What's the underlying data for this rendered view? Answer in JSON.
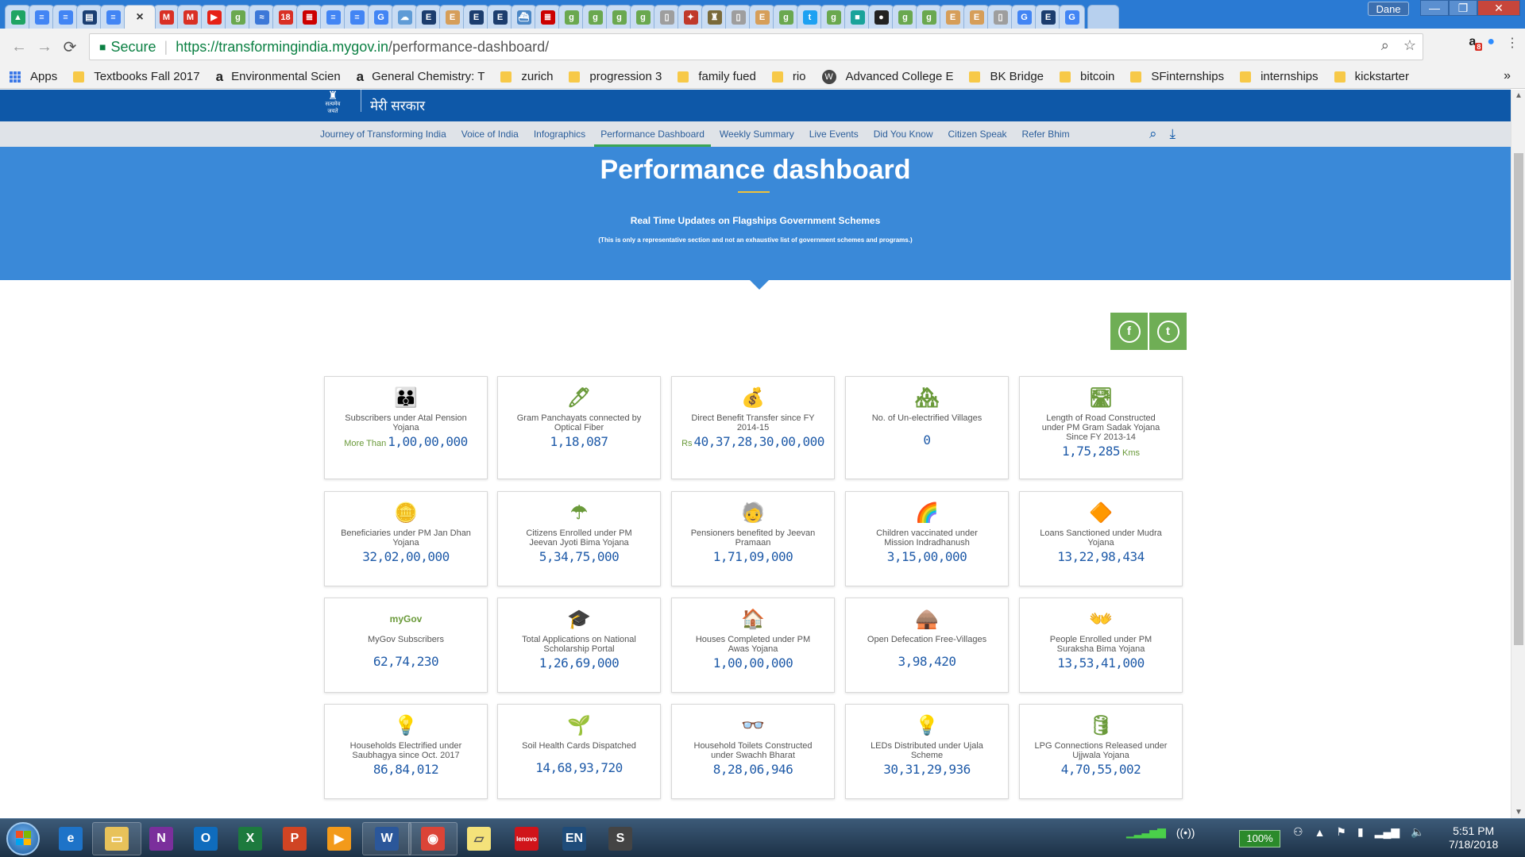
{
  "browser": {
    "tabs": [
      {
        "icon": "drive-icon",
        "glyph": "▲",
        "color": "#1fa463"
      },
      {
        "icon": "docs-icon",
        "glyph": "≡",
        "color": "#4285f4"
      },
      {
        "icon": "docs-icon",
        "glyph": "≡",
        "color": "#4285f4"
      },
      {
        "icon": "ieee-icon",
        "glyph": "▤",
        "color": "#1b3f73"
      },
      {
        "icon": "docs-icon",
        "glyph": "≡",
        "color": "#4285f4"
      },
      {
        "icon": "close-icon",
        "glyph": "×",
        "color": "#f2f2f2",
        "active": true
      },
      {
        "icon": "gmail-icon",
        "glyph": "M",
        "color": "#d93025"
      },
      {
        "icon": "gmail-icon",
        "glyph": "M",
        "color": "#d93025"
      },
      {
        "icon": "youtube-icon",
        "glyph": "▶",
        "color": "#e62117"
      },
      {
        "icon": "mygov-icon",
        "glyph": "g",
        "color": "#6aa84f"
      },
      {
        "icon": "water-icon",
        "glyph": "≈",
        "color": "#3c78d8"
      },
      {
        "icon": "calendar-icon",
        "glyph": "18",
        "color": "#d93025"
      },
      {
        "icon": "bars-icon",
        "glyph": "≣",
        "color": "#cc0000"
      },
      {
        "icon": "docs-icon",
        "glyph": "≡",
        "color": "#4285f4"
      },
      {
        "icon": "docs-icon",
        "glyph": "≡",
        "color": "#4285f4"
      },
      {
        "icon": "google-icon",
        "glyph": "G",
        "color": "#4285f4"
      },
      {
        "icon": "cloud-icon",
        "glyph": "☁",
        "color": "#5f9bd6"
      },
      {
        "icon": "e-icon",
        "glyph": "E",
        "color": "#1c3d6e"
      },
      {
        "icon": "e-book-icon",
        "glyph": "E",
        "color": "#d69e59"
      },
      {
        "icon": "e-icon",
        "glyph": "E",
        "color": "#1c3d6e"
      },
      {
        "icon": "e-icon",
        "glyph": "E",
        "color": "#1c3d6e"
      },
      {
        "icon": "ship-icon",
        "glyph": "⛴",
        "color": "#4a86c5"
      },
      {
        "icon": "bars-icon",
        "glyph": "≣",
        "color": "#cc0000"
      },
      {
        "icon": "mygov-icon",
        "glyph": "g",
        "color": "#6aa84f"
      },
      {
        "icon": "mygov-icon",
        "glyph": "g",
        "color": "#6aa84f"
      },
      {
        "icon": "mygov-icon",
        "glyph": "g",
        "color": "#6aa84f"
      },
      {
        "icon": "mygov-icon",
        "glyph": "g",
        "color": "#6aa84f"
      },
      {
        "icon": "page-icon",
        "glyph": "▯",
        "color": "#9e9e9e"
      },
      {
        "icon": "bird-icon",
        "glyph": "✦",
        "color": "#c0392b"
      },
      {
        "icon": "emblem-icon",
        "glyph": "♜",
        "color": "#7a6a3a"
      },
      {
        "icon": "page-icon",
        "glyph": "▯",
        "color": "#9e9e9e"
      },
      {
        "icon": "e-book-icon",
        "glyph": "E",
        "color": "#d69e59"
      },
      {
        "icon": "mygov-icon",
        "glyph": "g",
        "color": "#6aa84f"
      },
      {
        "icon": "twitter-icon",
        "glyph": "t",
        "color": "#1da1f2"
      },
      {
        "icon": "mygov-icon",
        "glyph": "g",
        "color": "#6aa84f"
      },
      {
        "icon": "teal-square-icon",
        "glyph": "■",
        "color": "#1aa39a"
      },
      {
        "icon": "github-icon",
        "glyph": "●",
        "color": "#222222"
      },
      {
        "icon": "mygov-icon",
        "glyph": "g",
        "color": "#6aa84f"
      },
      {
        "icon": "mygov-icon",
        "glyph": "g",
        "color": "#6aa84f"
      },
      {
        "icon": "e-book-icon",
        "glyph": "E",
        "color": "#d69e59"
      },
      {
        "icon": "e-book-icon",
        "glyph": "E",
        "color": "#d69e59"
      },
      {
        "icon": "page-icon",
        "glyph": "▯",
        "color": "#9e9e9e"
      },
      {
        "icon": "google-icon",
        "glyph": "G",
        "color": "#4285f4"
      },
      {
        "icon": "e-icon",
        "glyph": "E",
        "color": "#1c3d6e"
      },
      {
        "icon": "google-icon",
        "glyph": "G",
        "color": "#4285f4"
      }
    ],
    "user": "Dane",
    "window_buttons": {
      "minimize": "—",
      "maximize": "❐",
      "close": "✕"
    },
    "address": {
      "secure_label": "Secure",
      "url_scheme": "https://",
      "url_host": "transformingindia.mygov.in",
      "url_path": "/performance-dashboard/"
    },
    "bookmarks": [
      {
        "type": "apps",
        "label": "Apps"
      },
      {
        "type": "folder",
        "label": "Textbooks Fall 2017"
      },
      {
        "type": "amazon",
        "label": "Environmental Scien"
      },
      {
        "type": "amazon",
        "label": "General Chemistry: T"
      },
      {
        "type": "folder",
        "label": "zurich"
      },
      {
        "type": "folder",
        "label": "progression 3"
      },
      {
        "type": "folder",
        "label": "family fued"
      },
      {
        "type": "folder",
        "label": "rio"
      },
      {
        "type": "wordpress",
        "label": "Advanced College E"
      },
      {
        "type": "folder",
        "label": "BK Bridge"
      },
      {
        "type": "folder",
        "label": "bitcoin"
      },
      {
        "type": "folder",
        "label": "SFinternships"
      },
      {
        "type": "folder",
        "label": "internships"
      },
      {
        "type": "folder",
        "label": "kickstarter"
      }
    ],
    "bookmarks_more": "»",
    "extension_badge": "8"
  },
  "site": {
    "logo_hindi": "मेरी सरकार",
    "logo_emblem_caption": "सत्यमेव जयते",
    "nav": [
      {
        "label": "Journey of Transforming India",
        "active": false
      },
      {
        "label": "Voice of India",
        "active": false
      },
      {
        "label": "Infographics",
        "active": false
      },
      {
        "label": "Performance Dashboard",
        "active": true
      },
      {
        "label": "Weekly Summary",
        "active": false
      },
      {
        "label": "Live Events",
        "active": false
      },
      {
        "label": "Did You Know",
        "active": false
      },
      {
        "label": "Citizen Speak",
        "active": false
      },
      {
        "label": "Refer Bhim",
        "active": false
      }
    ],
    "hero": {
      "title": "Performance dashboard",
      "subtitle": "Real Time Updates on Flagships Government Schemes",
      "note": "(This is only a representative section and not an exhaustive list of government schemes and programs.)"
    },
    "share": {
      "facebook": "f",
      "twitter": "t"
    },
    "colors": {
      "header": "#0e58a8",
      "hero": "#3a89d8",
      "value": "#1e5aa8",
      "share": "#6fae55",
      "accent": "#3aa655"
    },
    "cards": [
      {
        "title": "Subscribers under Atal Pension Yojana",
        "prefix": "More Than",
        "value": "1,00,00,000",
        "suffix": "",
        "icon": "pension-family-icon",
        "emoji": "👪"
      },
      {
        "title": "Gram Panchayats connected by Optical Fiber",
        "prefix": "",
        "value": "1,18,087",
        "suffix": "",
        "icon": "optical-fiber-icon",
        "emoji": "🖊"
      },
      {
        "title": "Direct Benefit Transfer since FY 2014-15",
        "prefix": "Rs",
        "value": "40,37,28,30,00,000",
        "suffix": "",
        "icon": "money-bag-icon",
        "emoji": "💰"
      },
      {
        "title": "No. of Un-electrified Villages",
        "prefix": "",
        "value": "0",
        "suffix": "",
        "icon": "village-icon",
        "emoji": "🏘"
      },
      {
        "title": "Length of Road Constructed under PM Gram Sadak Yojana Since FY 2013-14",
        "prefix": "",
        "value": "1,75,285",
        "suffix": "Kms",
        "icon": "road-icon",
        "emoji": "🛣"
      },
      {
        "title": "Beneficiaries under PM Jan Dhan Yojana",
        "prefix": "",
        "value": "32,02,00,000",
        "suffix": "",
        "icon": "coins-icon",
        "emoji": "🪙"
      },
      {
        "title": "Citizens Enrolled under PM Jeevan Jyoti Bima Yojana",
        "prefix": "",
        "value": "5,34,75,000",
        "suffix": "",
        "icon": "umbrella-family-icon",
        "emoji": "☂"
      },
      {
        "title": "Pensioners benefited by Jeevan Pramaan",
        "prefix": "",
        "value": "1,71,09,000",
        "suffix": "",
        "icon": "pensioner-icon",
        "emoji": "🧓"
      },
      {
        "title": "Children vaccinated under Mission Indradhanush",
        "prefix": "",
        "value": "3,15,00,000",
        "suffix": "",
        "icon": "rainbow-icon",
        "emoji": "🌈"
      },
      {
        "title": "Loans Sanctioned under Mudra Yojana",
        "prefix": "",
        "value": "13,22,98,434",
        "suffix": "",
        "icon": "mudra-logo-icon",
        "emoji": "🔶"
      },
      {
        "title": "MyGov Subscribers",
        "prefix": "",
        "value": "62,74,230",
        "suffix": "",
        "icon": "mygov-logo-icon",
        "emoji": "myGov"
      },
      {
        "title": "Total Applications on National Scholarship Portal",
        "prefix": "",
        "value": "1,26,69,000",
        "suffix": "",
        "icon": "graduation-cap-icon",
        "emoji": "🎓"
      },
      {
        "title": "Houses Completed under PM Awas Yojana",
        "prefix": "",
        "value": "1,00,00,000",
        "suffix": "",
        "icon": "house-icon",
        "emoji": "🏠"
      },
      {
        "title": "Open Defecation Free-Villages",
        "prefix": "",
        "value": "3,98,420",
        "suffix": "",
        "icon": "hut-tree-icon",
        "emoji": "🛖"
      },
      {
        "title": "People Enrolled under PM Suraksha Bima Yojana",
        "prefix": "",
        "value": "13,53,41,000",
        "suffix": "",
        "icon": "protected-family-icon",
        "emoji": "👐"
      },
      {
        "title": "Households Electrified under Saubhagya since Oct. 2017",
        "prefix": "",
        "value": "86,84,012",
        "suffix": "",
        "icon": "bulbs-icon",
        "emoji": "💡"
      },
      {
        "title": "Soil Health Cards Dispatched",
        "prefix": "",
        "value": "14,68,93,720",
        "suffix": "",
        "icon": "plant-hands-icon",
        "emoji": "🌱"
      },
      {
        "title": "Household Toilets Constructed under Swachh Bharat",
        "prefix": "",
        "value": "8,28,06,946",
        "suffix": "",
        "icon": "swachh-glasses-icon",
        "emoji": "👓"
      },
      {
        "title": "LEDs Distributed under Ujala Scheme",
        "prefix": "",
        "value": "30,31,29,936",
        "suffix": "",
        "icon": "led-hand-icon",
        "emoji": "💡"
      },
      {
        "title": "LPG Connections Released under Ujjwala Yojana",
        "prefix": "",
        "value": "4,70,55,002",
        "suffix": "",
        "icon": "lpg-cylinder-icon",
        "emoji": "🛢"
      }
    ]
  },
  "taskbar": {
    "apps": [
      {
        "name": "ie-icon",
        "glyph": "e",
        "bg": "#1e73c8"
      },
      {
        "name": "explorer-icon",
        "glyph": "▭",
        "bg": "#e8c25a"
      },
      {
        "name": "onenote-icon",
        "glyph": "N",
        "bg": "#7b2f9c"
      },
      {
        "name": "outlook-icon",
        "glyph": "O",
        "bg": "#0f6cbd"
      },
      {
        "name": "excel-icon",
        "glyph": "X",
        "bg": "#1d7a3e"
      },
      {
        "name": "powerpoint-icon",
        "glyph": "P",
        "bg": "#d04423"
      },
      {
        "name": "media-player-icon",
        "glyph": "▶",
        "bg": "#f39a1a"
      },
      {
        "name": "word-icon",
        "glyph": "W",
        "bg": "#2b579a"
      },
      {
        "name": "chrome-icon",
        "glyph": "◉",
        "bg": "#db4437"
      },
      {
        "name": "sticky-notes-icon",
        "glyph": "▱",
        "bg": "#f4e27a"
      },
      {
        "name": "lenovo-icon",
        "glyph": "lenovo",
        "bg": "#d0141a"
      },
      {
        "name": "language-icon",
        "glyph": "EN",
        "bg": "#1f4c7a"
      },
      {
        "name": "app-s-icon",
        "glyph": "S",
        "bg": "#444444"
      }
    ],
    "battery": "100%",
    "time": "5:51 PM",
    "date": "7/18/2018"
  }
}
